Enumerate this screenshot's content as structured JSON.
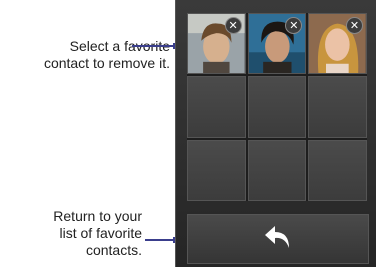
{
  "callouts": {
    "select_favorite": [
      "Select a favorite",
      "contact to remove it."
    ],
    "return_to_list": [
      "Return to your",
      "list of favorite",
      "contacts."
    ]
  },
  "favorites": {
    "contacts": [
      {
        "has_photo": true,
        "remove_icon": "close-icon"
      },
      {
        "has_photo": true,
        "remove_icon": "close-icon"
      },
      {
        "has_photo": true,
        "remove_icon": "close-icon"
      }
    ],
    "remove_symbol": "✕"
  },
  "bottom_bar": {
    "back_icon": "back-arrow-icon"
  },
  "colors": {
    "leader": "#3a3e8c",
    "panel_bg": "#2e2e2e"
  }
}
